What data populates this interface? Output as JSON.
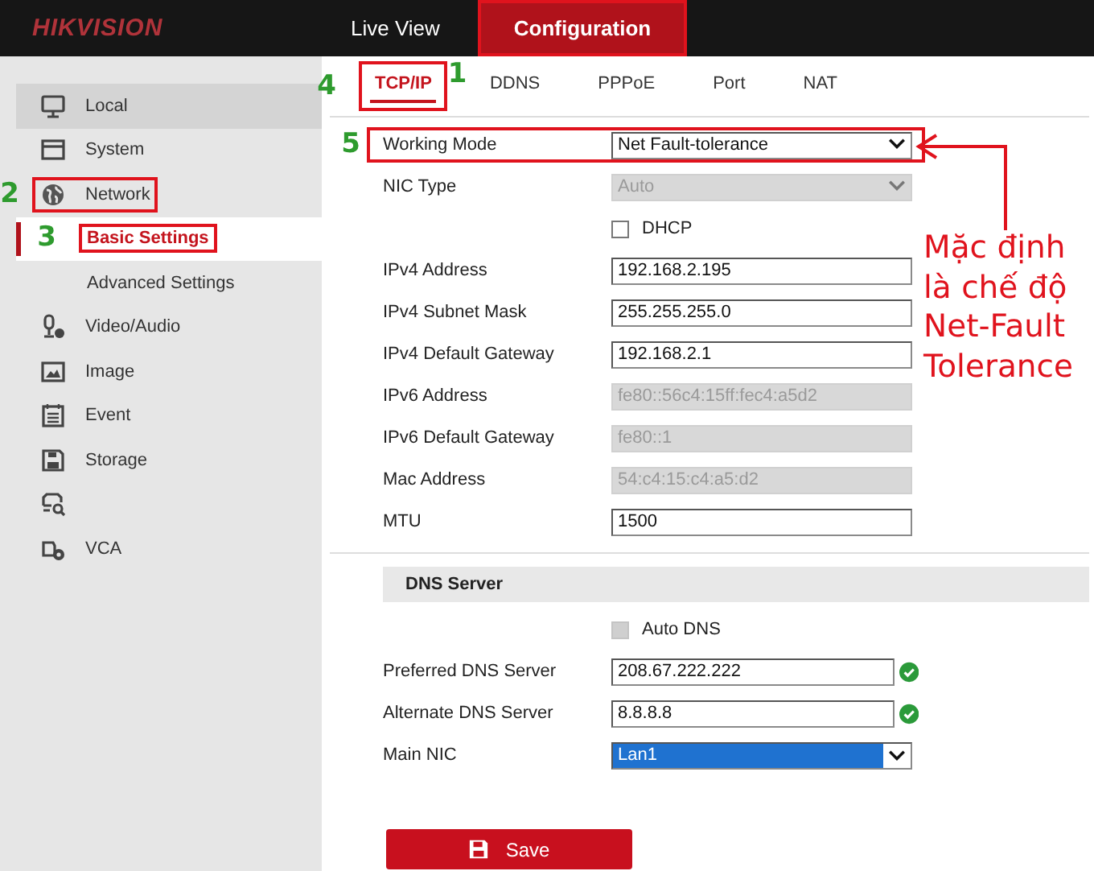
{
  "header": {
    "logo": "HIKVISION",
    "nav": [
      {
        "label": "Live View",
        "selected": false,
        "highlighted": false
      },
      {
        "label": "Configuration",
        "selected": true,
        "highlighted": true,
        "step": "1"
      }
    ]
  },
  "sidebar": {
    "items": [
      {
        "label": "Local",
        "selected": false,
        "shaded": true,
        "highlighted": false
      },
      {
        "label": "System",
        "selected": false,
        "shaded": false,
        "highlighted": false
      },
      {
        "label": "Network",
        "selected": false,
        "shaded": false,
        "highlighted": true,
        "step": "2",
        "children": [
          {
            "label": "Basic Settings",
            "selected": true,
            "shaded": false,
            "highlighted": true,
            "step": "3"
          },
          {
            "label": "Advanced Settings",
            "selected": false,
            "shaded": false,
            "highlighted": false
          }
        ]
      },
      {
        "label": "Video/Audio",
        "selected": false,
        "shaded": false,
        "highlighted": false
      },
      {
        "label": "Image",
        "selected": false,
        "shaded": false,
        "highlighted": false
      },
      {
        "label": "Event",
        "selected": false,
        "shaded": false,
        "highlighted": false
      },
      {
        "label": "Storage",
        "selected": false,
        "shaded": false,
        "highlighted": false
      },
      {
        "selected": false,
        "shaded": false,
        "highlighted": false
      },
      {
        "label": "VCA",
        "selected": false,
        "shaded": false,
        "highlighted": false
      }
    ]
  },
  "tabs": [
    {
      "label": "TCP/IP",
      "selected": true,
      "highlighted": true,
      "step": "4"
    },
    {
      "label": "DDNS",
      "selected": false,
      "highlighted": false
    },
    {
      "label": "PPPoE",
      "selected": false,
      "highlighted": false
    },
    {
      "label": "Port",
      "selected": false,
      "highlighted": false
    },
    {
      "label": "NAT",
      "selected": false,
      "highlighted": false
    }
  ],
  "form": {
    "rows": [
      {
        "kind": "select",
        "label": "Working Mode",
        "value": "Net Fault-tolerance",
        "disabled": false,
        "focused": false,
        "highlighted": true,
        "step": "5"
      },
      {
        "kind": "select",
        "label": "NIC Type",
        "value": "Auto",
        "disabled": true,
        "focused": false,
        "highlighted": false
      },
      {
        "kind": "checkbox",
        "label": "DHCP",
        "checked": false,
        "disabled": false,
        "highlighted": false
      },
      {
        "kind": "text",
        "label": "IPv4 Address",
        "value": "192.168.2.195",
        "disabled": false,
        "valid": false,
        "highlighted": false
      },
      {
        "kind": "text",
        "label": "IPv4 Subnet Mask",
        "value": "255.255.255.0",
        "disabled": false,
        "valid": false,
        "highlighted": false
      },
      {
        "kind": "text",
        "label": "IPv4 Default Gateway",
        "value": "192.168.2.1",
        "disabled": false,
        "valid": false,
        "highlighted": false
      },
      {
        "kind": "text",
        "label": "IPv6 Address",
        "value": "fe80::56c4:15ff:fec4:a5d2",
        "disabled": true,
        "valid": false,
        "highlighted": false
      },
      {
        "kind": "text",
        "label": "IPv6 Default Gateway",
        "value": "fe80::1",
        "disabled": true,
        "valid": false,
        "highlighted": false
      },
      {
        "kind": "text",
        "label": "Mac Address",
        "value": "54:c4:15:c4:a5:d2",
        "disabled": true,
        "valid": false,
        "highlighted": false
      },
      {
        "kind": "text",
        "label": "MTU",
        "value": "1500",
        "disabled": false,
        "valid": false,
        "highlighted": false
      }
    ]
  },
  "dns_section": {
    "title": "DNS Server",
    "rows": [
      {
        "kind": "checkbox",
        "label": "Auto DNS",
        "checked": false,
        "disabled": true,
        "highlighted": false
      },
      {
        "kind": "text",
        "label": "Preferred DNS Server",
        "value": "208.67.222.222",
        "disabled": false,
        "valid": true,
        "highlighted": false
      },
      {
        "kind": "text",
        "label": "Alternate DNS Server",
        "value": "8.8.8.8",
        "disabled": false,
        "valid": true,
        "highlighted": false
      },
      {
        "kind": "select",
        "label": "Main NIC",
        "value": "Lan1",
        "disabled": false,
        "focused": true,
        "highlighted": false
      }
    ]
  },
  "save_button": {
    "label": "Save"
  },
  "callout": {
    "text": "Mặc định là chế độ Net-Fault Tolerance"
  }
}
